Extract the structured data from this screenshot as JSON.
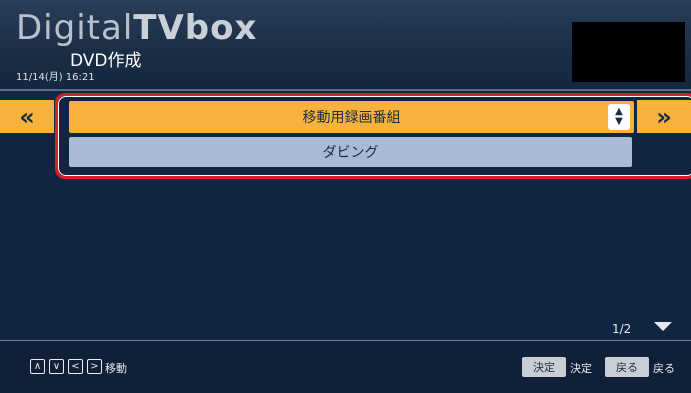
{
  "header": {
    "logo_thin": "Digital",
    "logo_bold": "TVbox",
    "screen_title": "DVD作成",
    "datetime": "11/14(月) 16:21"
  },
  "selector": {
    "prev_glyph": "«",
    "next_glyph": "»",
    "options": [
      {
        "label": "移動用録画番組",
        "selected": true
      },
      {
        "label": "ダビング",
        "selected": false
      }
    ]
  },
  "pager": {
    "page": "1/2"
  },
  "footer": {
    "nav_keys": [
      "up",
      "down",
      "left",
      "right"
    ],
    "nav_hint": "移動",
    "ok_button": "決定",
    "ok_hint": "決定",
    "back_button": "戻る",
    "back_hint": "戻る"
  },
  "colors": {
    "accent": "#f7b23b",
    "highlight_frame": "#d8202c",
    "option_bg": "#a9b9d6",
    "background": "#0f2540"
  }
}
